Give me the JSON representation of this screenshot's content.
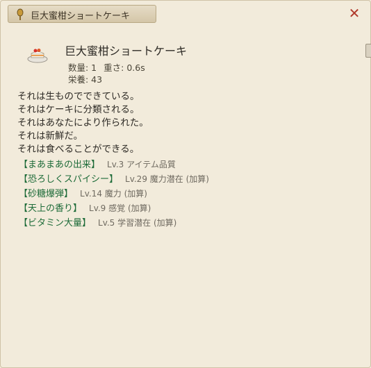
{
  "window": {
    "title": "巨大蜜柑ショートケーキ",
    "close_glyph": "✕"
  },
  "item": {
    "name": "巨大蜜柑ショートケーキ",
    "icon": "cake-icon",
    "stats": {
      "quantity": "数量: 1",
      "weight": "重さ: 0.6s",
      "nutrition": "栄養: 43"
    }
  },
  "descriptions": [
    "それは生ものでできている。",
    "それはケーキに分類される。",
    "それはあなたにより作られた。",
    "それは新鮮だ。",
    "それは食べることができる。"
  ],
  "enchantments": [
    {
      "name": "【まあまあの出来】",
      "detail": "Lv.3 アイテム品質"
    },
    {
      "name": "【恐ろしくスパイシー】",
      "detail": "Lv.29 魔力潜在 (加算)"
    },
    {
      "name": "【砂糖爆弾】",
      "detail": "Lv.14 魔力 (加算)"
    },
    {
      "name": "【天上の香り】",
      "detail": "Lv.9 感覚 (加算)"
    },
    {
      "name": "【ビタミン大量】",
      "detail": "Lv.5 学習潜在 (加算)"
    }
  ],
  "colors": {
    "enchant_name": "#1d6b38",
    "close": "#b0392b",
    "background": "#f2ebdb"
  }
}
